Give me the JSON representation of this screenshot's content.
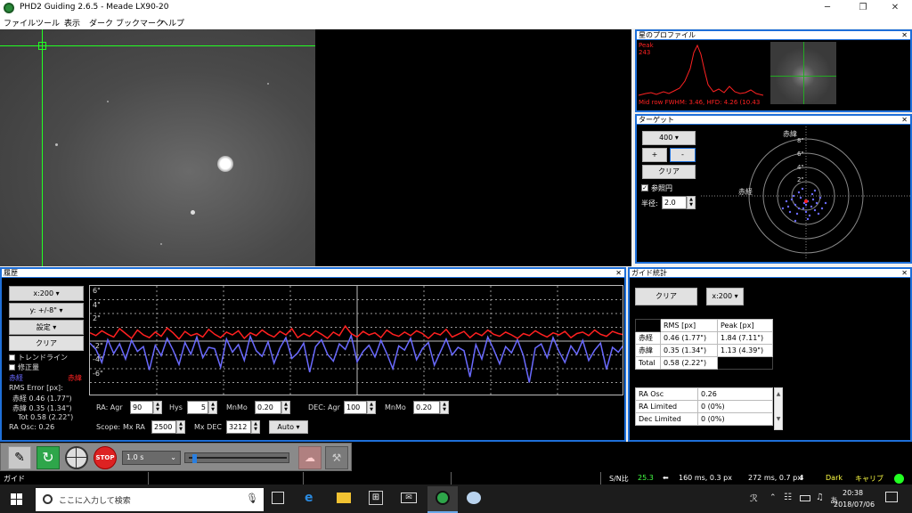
{
  "window": {
    "title": "PHD2 Guiding 2.6.5 - Meade LX90-20",
    "minimize": "─",
    "maximize": "❐",
    "close": "✕"
  },
  "menu": [
    "ファイル",
    "ツール",
    "表示",
    "ダーク",
    "ブックマーク",
    "ヘルプ"
  ],
  "star_profile": {
    "header": "星のプロファイル",
    "close": "✕",
    "peak_label": "Peak",
    "peak_value": "243",
    "fwhm_text": "Mid row FWHM: 3.46, HFD: 4.26 (10.43"
  },
  "target": {
    "header": "ターゲット",
    "close": "✕",
    "zoom_value": "400",
    "plus_label": "+",
    "minus_label": "-",
    "clear_label": "クリア",
    "ref_circle_label": "参照円",
    "radius_label": "半径:",
    "radius_value": "2.0",
    "dec_axis_label": "赤緯",
    "ra_axis_label": "赤経",
    "ring_labels": [
      "8\"",
      "6\"",
      "4\"",
      "2\""
    ]
  },
  "history": {
    "header": "履歴",
    "close": "✕",
    "x_scale": "x:200",
    "y_scale": "y: +/-8\"",
    "settings_label": "設定",
    "clear_label": "クリア",
    "trendline_label": "トレンドライン",
    "correction_label": "修正量",
    "ra_legend": "赤経",
    "dec_legend": "赤緯",
    "rms_title": "RMS Error [px]:",
    "rms_ra": "赤経  0.46 (1.77\")",
    "rms_dec": "赤緯  0.35 (1.34\")",
    "rms_tot": "Tot  0.58 (2.22\")",
    "ra_osc": "RA Osc: 0.26",
    "y_ticks": [
      "6\"",
      "4\"",
      "2\"",
      "-2\"",
      "-4\"",
      "-6\""
    ],
    "ra_agr_label": "RA: Agr",
    "ra_agr_value": "90",
    "hys_label": "Hys",
    "hys_value": "5",
    "mnmo_label": "MnMo",
    "ra_mnmo_value": "0.20",
    "dec_agr_label": "DEC: Agr",
    "dec_agr_value": "100",
    "dec_mnmo_value": "0.20",
    "scope_label": "Scope:",
    "mx_ra_label": "Mx RA",
    "mx_ra_value": "2500",
    "mx_dec_label": "Mx DEC",
    "mx_dec_value": "3212",
    "dec_mode": "Auto"
  },
  "guide_stats": {
    "header": "ガイド統計",
    "close": "✕",
    "clear_label": "クリア",
    "x_scale": "x:200",
    "col_rms": "RMS [px]",
    "col_peak": "Peak [px]",
    "rows": [
      {
        "label": "赤経",
        "rms": "0.46 (1.77\")",
        "peak": "1.84 (7.11\")"
      },
      {
        "label": "赤緯",
        "rms": "0.35 (1.34\")",
        "peak": "1.13 (4.39\")"
      },
      {
        "label": "Total",
        "rms": "0.58 (2.22\")",
        "peak": ""
      }
    ],
    "osc_rows": [
      {
        "label": "RA Osc",
        "value": "0.26"
      },
      {
        "label": "RA Limited",
        "value": "0 (0%)"
      },
      {
        "label": "Dec Limited",
        "value": "0 (0%)"
      }
    ]
  },
  "toolbar": {
    "exposure": "1.0 s"
  },
  "status": {
    "mode": "ガイド",
    "snr_label": "S/N比",
    "snr_value": "25.3",
    "ra_pulse": "160 ms, 0.3 px",
    "dec_pulse": "272 ms, 0.7 px",
    "dark": "Dark",
    "calib": "キャリブ"
  },
  "taskbar": {
    "search_placeholder": "ここに入力して検索",
    "time": "20:38",
    "date": "2018/07/06",
    "ime": "あ"
  },
  "chart_data": {
    "type": "line",
    "ylim": [
      -8,
      8
    ],
    "y_ticks": [
      "6\"",
      "4\"",
      "2\"",
      "-2\"",
      "-4\"",
      "-6\""
    ],
    "series": [
      {
        "name": "赤経",
        "color": "#6a6aff",
        "values": [
          -0.3,
          -1.2,
          -3.1,
          0.2,
          -1.8,
          -0.4,
          -2.6,
          0.1,
          -1.5,
          -0.8,
          -4.2,
          -0.6,
          -2.1,
          0.4,
          -1.3,
          -3.4,
          -0.2,
          -1.9,
          0.6,
          -2.4,
          -0.9,
          -1.1,
          -3.8,
          0.3,
          -1.6,
          -0.5,
          -2.8,
          0.7,
          -1.4,
          -2.2,
          -0.1,
          -3.2,
          -1.0,
          0.5,
          -2.5,
          -1.7,
          -0.3,
          -4.5,
          -0.8,
          0.2,
          -1.9,
          -2.9,
          -0.4,
          -1.2,
          0.8,
          -3.0,
          -1.5,
          -0.6,
          -2.3,
          0.1,
          -1.8,
          -4.0,
          -0.7,
          -1.3,
          0.4,
          -2.7,
          -1.1,
          -0.2,
          -3.5,
          -1.6,
          0.3,
          -2.0,
          -0.9,
          -1.4,
          -5.2,
          -0.5,
          -2.6,
          0.6,
          -1.2,
          -3.3,
          -0.8,
          -1.7,
          0.2,
          -2.1,
          -6.0,
          -1.0,
          -0.4,
          -2.4,
          0.5,
          -1.5,
          -3.1,
          -0.7,
          -1.9,
          0.1,
          -2.8,
          -1.3,
          -0.3,
          -4.1,
          -0.9,
          -1.6,
          -0.4
        ]
      },
      {
        "name": "赤緯",
        "color": "#ff2020",
        "values": [
          1.2,
          0.8,
          1.5,
          1.0,
          0.6,
          1.8,
          1.1,
          0.4,
          1.6,
          0.9,
          0.5,
          1.3,
          0.7,
          1.9,
          1.2,
          0.3,
          1.4,
          0.8,
          1.1,
          0.6,
          1.7,
          1.0,
          0.5,
          1.3,
          0.9,
          1.5,
          0.4,
          1.2,
          0.8,
          1.6,
          1.0,
          0.6,
          1.4,
          0.9,
          1.8,
          0.5,
          1.1,
          0.7,
          1.5,
          1.0,
          0.4,
          1.3,
          0.8,
          2.2,
          1.1,
          0.6,
          1.4,
          0.9,
          1.2,
          0.5,
          1.6,
          1.0,
          0.7,
          1.3,
          0.8,
          1.5,
          1.1,
          0.4,
          1.2,
          0.9,
          1.7,
          0.6,
          1.0,
          1.4,
          0.5,
          1.2,
          0.8,
          1.6,
          1.0,
          0.7,
          1.3,
          0.9,
          0.4,
          1.1,
          0.8,
          1.5,
          1.0,
          0.6,
          1.2,
          0.9,
          1.4,
          0.5,
          1.1,
          1.3,
          0.8,
          1.6,
          1.0,
          0.7,
          1.4,
          1.1,
          0.9
        ]
      }
    ]
  }
}
